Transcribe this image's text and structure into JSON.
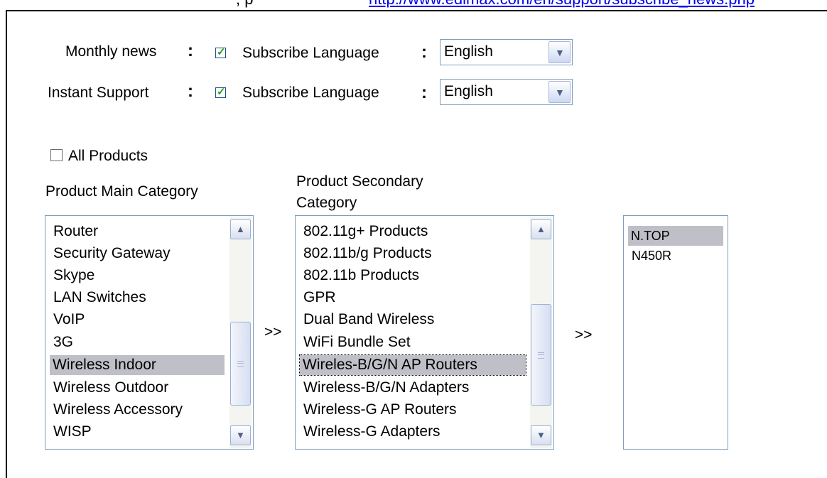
{
  "top_cut": {
    "text": ", p",
    "link": "http://www.edimax.com/en/support/subscribe_news.php"
  },
  "subscriptions": [
    {
      "label": "Monthly news",
      "checked": true,
      "subscribe_label": "Subscribe Language",
      "language": "English"
    },
    {
      "label": "Instant Support",
      "checked": true,
      "subscribe_label": "Subscribe Language",
      "language": "English"
    }
  ],
  "colon": ":",
  "all_products": {
    "label": "All Products",
    "checked": false
  },
  "main_category": {
    "heading": "Product Main Category",
    "items": [
      "Router",
      "Security Gateway",
      "Skype",
      "LAN Switches",
      "VoIP",
      "3G",
      "Wireless Indoor",
      "Wireless Outdoor",
      "Wireless Accessory",
      "WISP"
    ],
    "selected": "Wireless Indoor"
  },
  "secondary_category": {
    "heading_line1": "Product Secondary",
    "heading_line2": "Category",
    "items": [
      "802.11g+ Products",
      "802.11b/g Products",
      "802.11b Products",
      "GPR",
      "Dual Band Wireless",
      "WiFi Bundle Set",
      "Wireles-B/G/N AP Routers",
      "Wireless-B/G/N Adapters",
      "Wireless-G AP Routers",
      "Wireless-G Adapters"
    ],
    "selected": "Wireles-B/G/N AP Routers"
  },
  "models": {
    "items": [
      "N.TOP",
      "N450R"
    ],
    "selected": "N.TOP"
  },
  "arrow_label": ">>",
  "icons": {
    "checkmark": "checkmark-icon",
    "dropdown": "chevron-down-icon",
    "scroll_up": "chevron-up-icon",
    "scroll_down": "chevron-down-icon"
  }
}
